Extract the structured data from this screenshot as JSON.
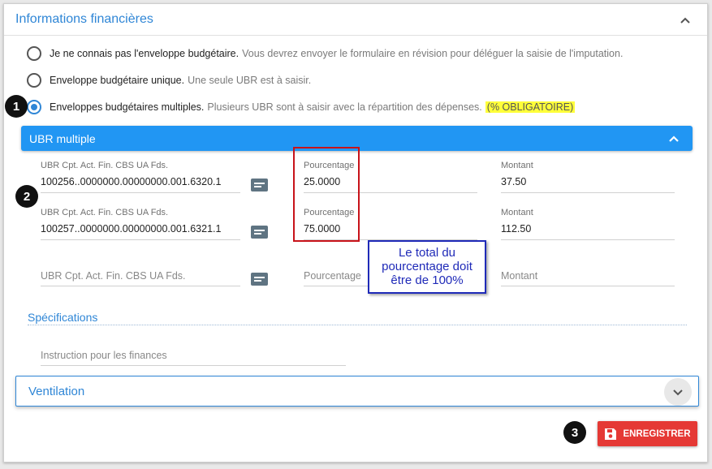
{
  "panel": {
    "title": "Informations financières"
  },
  "options": [
    {
      "label": "Je ne connais pas l'enveloppe budgétaire.",
      "desc": "Vous devrez envoyer le formulaire en révision pour déléguer la saisie de l'imputation.",
      "checked": false
    },
    {
      "label": "Enveloppe budgétaire unique.",
      "desc": "Une seule UBR est à saisir.",
      "checked": false
    },
    {
      "label": "Enveloppes budgétaires multiples.",
      "desc": "Plusieurs UBR sont à saisir avec la répartition des dépenses.",
      "mandatory": "(% OBLIGATOIRE)",
      "checked": true
    }
  ],
  "callouts": {
    "one": "1",
    "two": "2",
    "three": "3"
  },
  "ubr": {
    "title": "UBR multiple",
    "rows": [
      {
        "ubr_label": "UBR Cpt. Act. Fin. CBS UA Fds.",
        "ubr_value": "100256..0000000.00000000.001.6320.1",
        "pct_label": "Pourcentage",
        "pct_value": "25.0000",
        "amt_label": "Montant",
        "amt_value": "37.50"
      },
      {
        "ubr_label": "UBR Cpt. Act. Fin. CBS UA Fds.",
        "ubr_value": "100257..0000000.00000000.001.6321.1",
        "pct_label": "Pourcentage",
        "pct_value": "75.0000",
        "amt_label": "Montant",
        "amt_value": "112.50"
      }
    ],
    "empty_row": {
      "ubr_placeholder": "UBR Cpt. Act. Fin. CBS UA Fds.",
      "pct_placeholder": "Pourcentage",
      "amt_placeholder": "Montant"
    }
  },
  "annotation": {
    "line1": "Le total du",
    "line2": "pourcentage doit",
    "line3": "être de 100%"
  },
  "specs": {
    "title": "Spécifications",
    "instruction_placeholder": "Instruction pour les finances"
  },
  "ventilation": {
    "title": "Ventilation"
  },
  "save_button": {
    "label": "ENREGISTRER"
  },
  "colors": {
    "accent": "#2196f3",
    "link": "#2f86d6",
    "save": "#e53935",
    "highlight": "#ffff3a",
    "annotation_red": "#c8131a",
    "annotation_blue": "#1f2ab8"
  }
}
